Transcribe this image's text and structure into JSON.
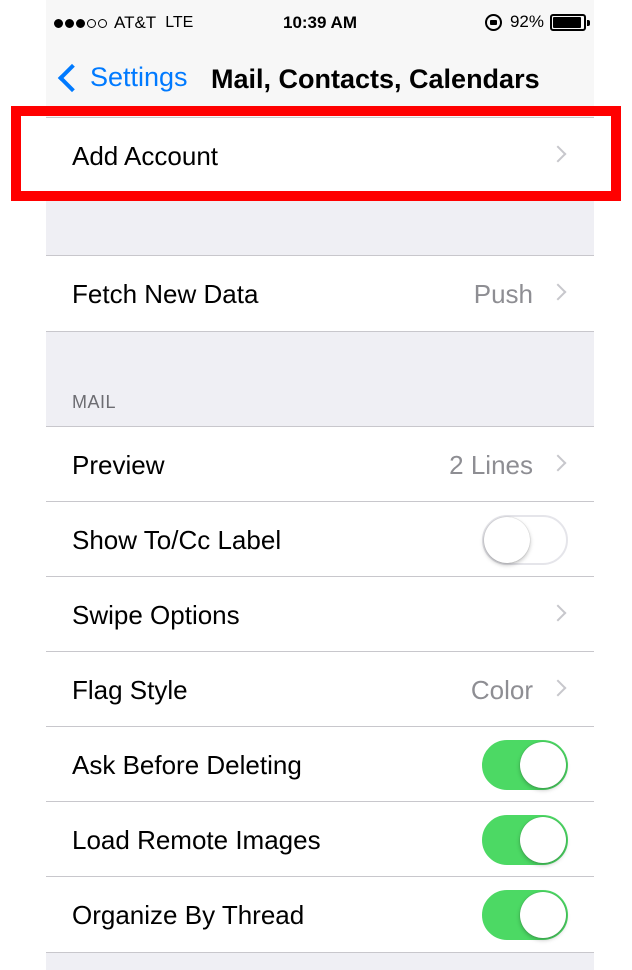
{
  "status_bar": {
    "signal_bars": [
      true,
      true,
      true,
      false,
      false
    ],
    "carrier": "AT&T",
    "network": "LTE",
    "time": "10:39 AM",
    "battery_percent": "92%",
    "battery_level": 0.92
  },
  "nav": {
    "back_label": "Settings",
    "title": "Mail, Contacts, Calendars"
  },
  "accounts": {
    "add_account_label": "Add Account"
  },
  "fetch": {
    "label": "Fetch New Data",
    "value": "Push"
  },
  "mail_section": {
    "header": "MAIL",
    "preview": {
      "label": "Preview",
      "value": "2 Lines"
    },
    "show_to_cc": {
      "label": "Show To/Cc Label",
      "on": false
    },
    "swipe_options": {
      "label": "Swipe Options"
    },
    "flag_style": {
      "label": "Flag Style",
      "value": "Color"
    },
    "ask_before_deleting": {
      "label": "Ask Before Deleting",
      "on": true
    },
    "load_remote_images": {
      "label": "Load Remote Images",
      "on": true
    },
    "organize_by_thread": {
      "label": "Organize By Thread",
      "on": true
    }
  },
  "colors": {
    "accent": "#007aff",
    "toggle_on": "#4cd964",
    "highlight": "#ff0000"
  }
}
